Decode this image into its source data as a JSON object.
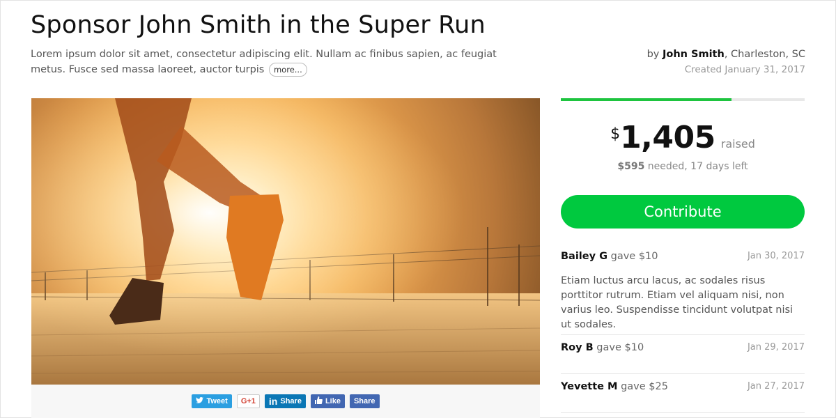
{
  "campaign": {
    "title": "Sponsor John Smith in the Super Run",
    "description": "Lorem ipsum dolor sit amet, consectetur adipiscing elit. Nullam ac finibus sapien, ac feugiat metus. Fusce sed massa laoreet, auctor turpis",
    "more_label": "more...",
    "by_prefix": "by",
    "author": "John Smith",
    "location": ", Charleston, SC",
    "created": "Created January 31, 2017"
  },
  "share": {
    "tweet_label": "Tweet",
    "gplus_label": "G+1",
    "linkedin_label": "Share",
    "like_label": "Like",
    "fb_share_label": "Share"
  },
  "funding": {
    "progress_fraction": 0.7,
    "currency": "$",
    "raised": "1,405",
    "raised_label": "raised",
    "needed_amount": "$595",
    "needed_text": " needed, 17 days left",
    "contribute_label": "Contribute"
  },
  "donations": [
    {
      "name": "Bailey G",
      "gave": "gave $10",
      "date": "Jan 30, 2017",
      "message": "Etiam luctus arcu lacus, ac sodales risus porttitor rutrum. Etiam vel aliquam nisi, non varius leo. Suspendisse tincidunt volutpat nisi ut sodales."
    },
    {
      "name": "Roy B",
      "gave": "gave $10",
      "date": "Jan 29, 2017"
    },
    {
      "name": "Yevette M",
      "gave": "gave $25",
      "date": "Jan 27, 2017"
    }
  ],
  "colors": {
    "accent_green": "#00c93f",
    "twitter": "#2b9fe1",
    "linkedin": "#0b77b5",
    "facebook": "#4267b2"
  }
}
